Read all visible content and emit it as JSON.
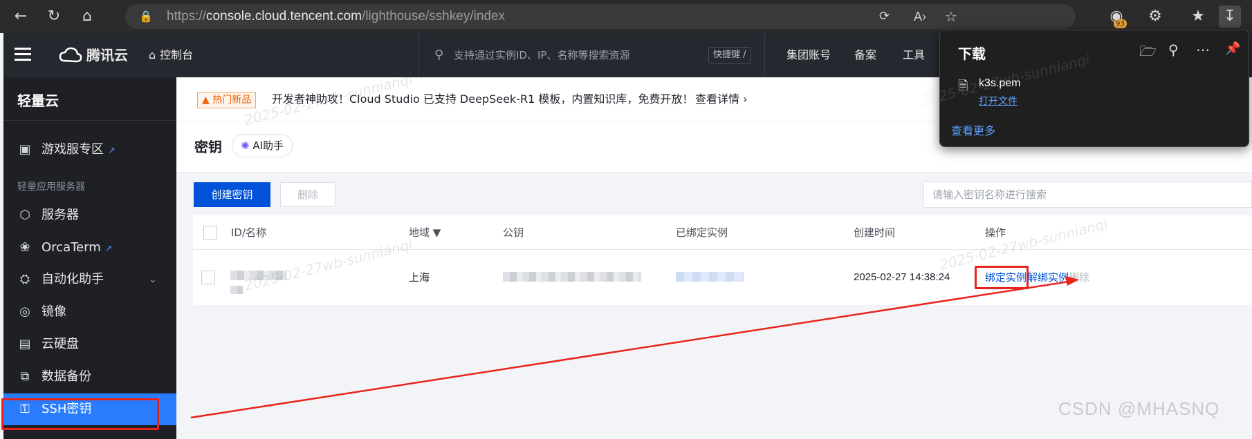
{
  "browser": {
    "url_prefix": "https://",
    "url_host": "console.cloud.tencent.com",
    "url_path": "/lighthouse/sshkey/index",
    "ext_badge": "93"
  },
  "topnav": {
    "brand": "腾讯云",
    "console": "控制台",
    "search_placeholder": "支持通过实例ID、IP、名称等搜索资源",
    "shortcut": "快捷键 /",
    "links": [
      "集团账号",
      "备案",
      "工具"
    ]
  },
  "sidebar": {
    "title": "轻量云",
    "game_zone": "游戏服专区",
    "section": "轻量应用服务器",
    "items": [
      "服务器",
      "OrcaTerm",
      "自动化助手",
      "镜像",
      "云硬盘",
      "数据备份",
      "SSH密钥"
    ]
  },
  "banner": {
    "tag": "热门新品",
    "text": "开发者神助攻！Cloud Studio 已支持 DeepSeek-R1 模板，内置知识库，免费开放！",
    "link": "查看详情"
  },
  "page": {
    "title": "密钥",
    "ai_button": "AI助手",
    "create_button": "创建密钥",
    "delete_button": "删除",
    "search_placeholder": "请输入密钥名称进行搜索"
  },
  "table": {
    "headers": [
      "ID/名称",
      "地域",
      "公钥",
      "已绑定实例",
      "创建时间",
      "操作"
    ],
    "rows": [
      {
        "region": "上海",
        "created": "2025-02-27 14:38:24",
        "actions": [
          "绑定实例",
          "解绑实例",
          "删除"
        ]
      }
    ]
  },
  "download": {
    "title": "下载",
    "file_name": "k3s.pem",
    "open_file": "打开文件",
    "see_more": "查看更多"
  },
  "watermark": "2025-02-27wb-sunnianqi",
  "csdn_mark": "CSDN @MHASNQ",
  "colors": {
    "primary": "#0052d9",
    "annotation_red": "#e8231b",
    "active_sidebar": "#2a7cff"
  }
}
